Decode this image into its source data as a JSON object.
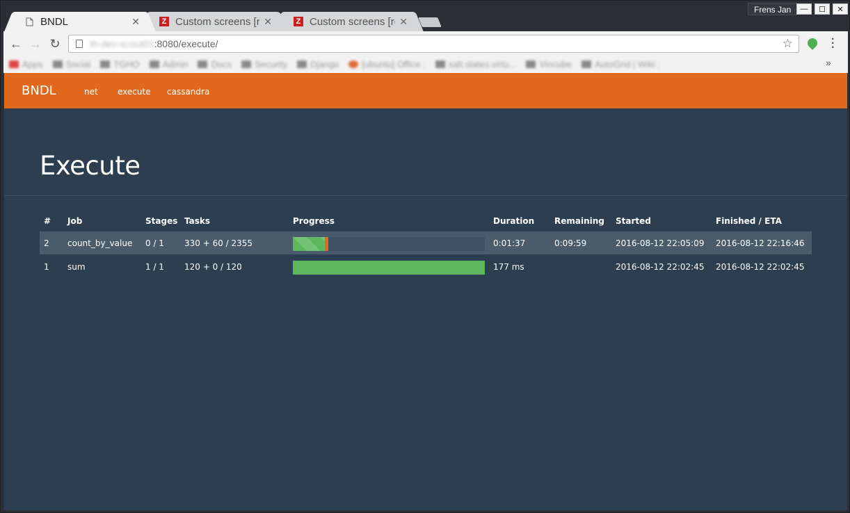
{
  "browser": {
    "tabs": [
      {
        "title": "BNDL",
        "icon": "document-icon",
        "active": true
      },
      {
        "title": "Custom screens [re",
        "icon": "z-app-icon",
        "active": false
      },
      {
        "title": "Custom screens [re",
        "icon": "z-app-icon",
        "active": false
      }
    ],
    "profile_name": "Frens Jan",
    "url_host": "th-dev-scout01",
    "url_rest": ":8080/execute/",
    "bookmarks": [
      "Apps",
      "Social",
      "TGHO",
      "Admin",
      "Docs",
      "Security",
      "Django",
      "[ubuntu] Office :",
      "salt.states.virtu...",
      "Vincube",
      "AutoGrid | Wiki :"
    ]
  },
  "app": {
    "brand": "BNDL",
    "nav": [
      "net",
      "execute",
      "cassandra"
    ],
    "page_title": "Execute"
  },
  "table": {
    "headers": [
      "#",
      "Job",
      "Stages",
      "Tasks",
      "Progress",
      "Duration",
      "Remaining",
      "Started",
      "Finished / ETA"
    ],
    "rows": [
      {
        "id": "2",
        "job": "count_by_value",
        "stages": "0 / 1",
        "tasks": "330 + 60 / 2355",
        "progress_done": 0.14,
        "progress_running": 0.025,
        "progress_failed": 0.02,
        "duration": "0:01:37",
        "remaining": "0:09:59",
        "started": "2016-08-12 22:05:09",
        "finished": "2016-08-12 22:16:46",
        "highlighted": true
      },
      {
        "id": "1",
        "job": "sum",
        "stages": "1 / 1",
        "tasks": "120 + 0 / 120",
        "progress_done": 1.0,
        "progress_running": 0,
        "progress_failed": 0,
        "duration": "177 ms",
        "remaining": "",
        "started": "2016-08-12 22:02:45",
        "finished": "2016-08-12 22:02:45",
        "highlighted": false
      }
    ]
  },
  "colors": {
    "navbar": "#e0691e",
    "background": "#2c3e50",
    "success": "#5cb85c",
    "warning": "#e0691e"
  }
}
